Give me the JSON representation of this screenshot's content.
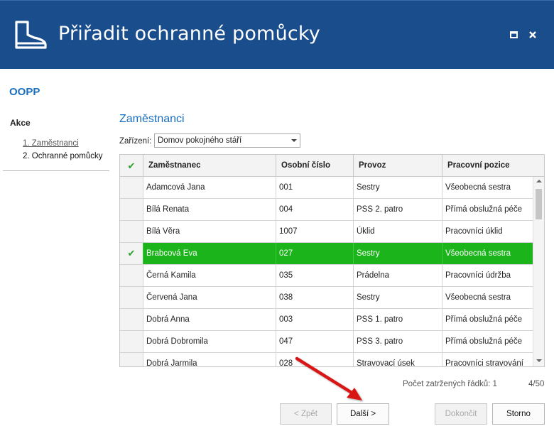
{
  "window": {
    "title": "Přiřadit ochranné pomůcky",
    "icon": "boot-icon",
    "accent_color": "#1a4d8c"
  },
  "module_title": "OOPP",
  "sidebar": {
    "heading": "Akce",
    "steps": [
      {
        "label": "1. Zaměstnanci"
      },
      {
        "label": "2. Ochranné pomůcky"
      }
    ]
  },
  "main": {
    "section_title": "Zaměstnanci",
    "device": {
      "label": "Zařízení:",
      "value": "Domov pokojného stáří"
    },
    "table": {
      "columns": [
        "Zaměstnanec",
        "Osobní číslo",
        "Provoz",
        "Pracovní pozice"
      ],
      "check_glyph": "✔",
      "rows": [
        {
          "checked": false,
          "name": "Adamcová Jana",
          "number": "001",
          "provoz": "Sestry",
          "pozice": "Všeobecná sestra"
        },
        {
          "checked": false,
          "name": "Bílá Renata",
          "number": "004",
          "provoz": "PSS 2. patro",
          "pozice": "Přímá obslužná péče"
        },
        {
          "checked": false,
          "name": "Bílá Věra",
          "number": "1007",
          "provoz": "Úklid",
          "pozice": "Pracovníci úklid"
        },
        {
          "checked": true,
          "name": "Brabcová Eva",
          "number": "027",
          "provoz": "Sestry",
          "pozice": "Všeobecná sestra"
        },
        {
          "checked": false,
          "name": "Černá Kamila",
          "number": "035",
          "provoz": "Prádelna",
          "pozice": "Pracovníci údržba"
        },
        {
          "checked": false,
          "name": "Červená Jana",
          "number": "038",
          "provoz": "Sestry",
          "pozice": "Všeobecná sestra"
        },
        {
          "checked": false,
          "name": "Dobrá Anna",
          "number": "003",
          "provoz": "PSS 1. patro",
          "pozice": "Přímá obslužná péče"
        },
        {
          "checked": false,
          "name": "Dobrá Dobromila",
          "number": "047",
          "provoz": "PSS 3. patro",
          "pozice": "Přímá obslužná péče"
        },
        {
          "checked": false,
          "name": "Dobrá Jarmila",
          "number": "028",
          "provoz": "Stravovací úsek",
          "pozice": "Pracovníci stravování"
        }
      ],
      "selected_color": "#1bb41b"
    },
    "status": {
      "count_label": "Počet zatržených řádků: 1",
      "page": "4/50"
    }
  },
  "buttons": {
    "back": "< Zpět",
    "next": "Další >",
    "finish": "Dokončit",
    "cancel": "Storno"
  },
  "annotation": {
    "arrow_color": "#d81818"
  }
}
